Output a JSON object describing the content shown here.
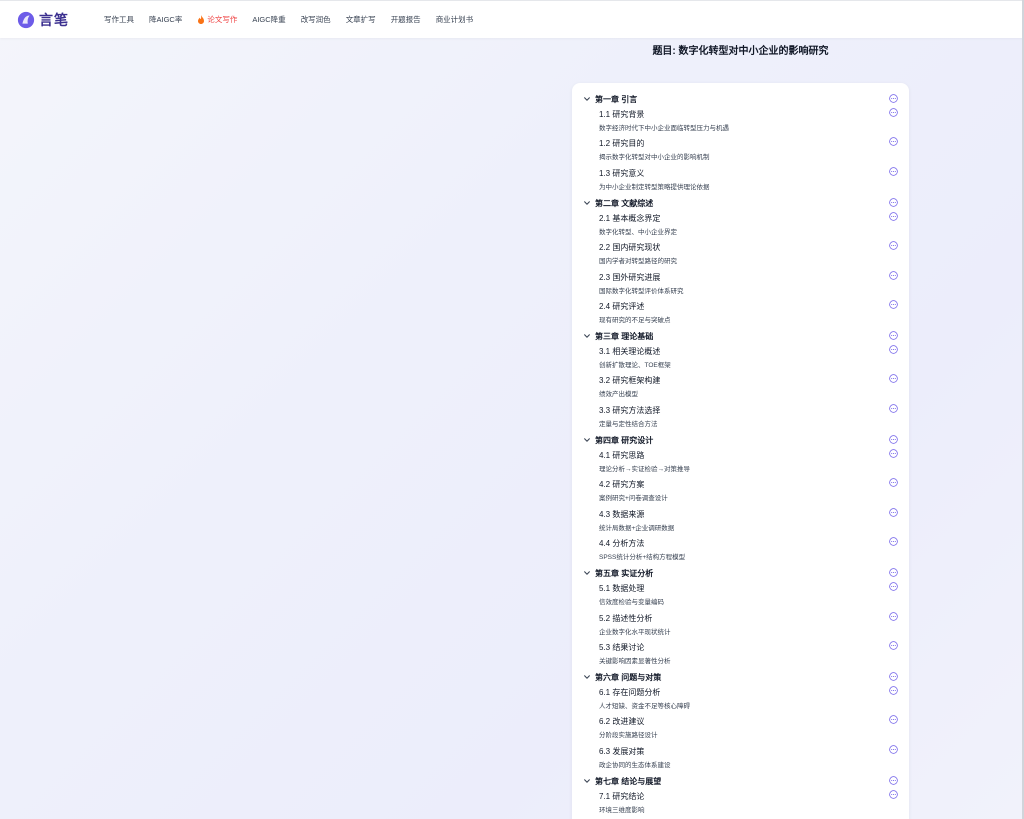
{
  "brand": {
    "name": "言笔"
  },
  "nav": [
    {
      "label": "写作工具",
      "active": false
    },
    {
      "label": "降AIGC率",
      "active": false
    },
    {
      "label": "论文写作",
      "active": true
    },
    {
      "label": "AIGC降重",
      "active": false
    },
    {
      "label": "改写润色",
      "active": false
    },
    {
      "label": "文章扩写",
      "active": false
    },
    {
      "label": "开题报告",
      "active": false
    },
    {
      "label": "商业计划书",
      "active": false
    }
  ],
  "paper": {
    "title": "题目: 数字化转型对中小企业的影响研究"
  },
  "outline": [
    {
      "title": "第一章 引言",
      "sections": [
        {
          "title": "1.1 研究背景",
          "desc": "数字经济时代下中小企业面临转型压力与机遇"
        },
        {
          "title": "1.2 研究目的",
          "desc": "揭示数字化转型对中小企业的影响机制"
        },
        {
          "title": "1.3 研究意义",
          "desc": "为中小企业制定转型策略提供理论依据"
        }
      ]
    },
    {
      "title": "第二章 文献综述",
      "sections": [
        {
          "title": "2.1 基本概念界定",
          "desc": "数字化转型、中小企业界定"
        },
        {
          "title": "2.2 国内研究现状",
          "desc": "国内学者对转型路径的研究"
        },
        {
          "title": "2.3 国外研究进展",
          "desc": "国际数字化转型评价体系研究"
        },
        {
          "title": "2.4 研究评述",
          "desc": "现有研究的不足与突破点"
        }
      ]
    },
    {
      "title": "第三章 理论基础",
      "sections": [
        {
          "title": "3.1 相关理论概述",
          "desc": "创新扩散理论、TOE框架"
        },
        {
          "title": "3.2 研究框架构建",
          "desc": "绩效产出模型"
        },
        {
          "title": "3.3 研究方法选择",
          "desc": "定量与定性结合方法"
        }
      ]
    },
    {
      "title": "第四章 研究设计",
      "sections": [
        {
          "title": "4.1 研究思路",
          "desc": "理论分析→实证检验→对策推导"
        },
        {
          "title": "4.2 研究方案",
          "desc": "案例研究+问卷调查设计"
        },
        {
          "title": "4.3 数据来源",
          "desc": "统计局数据+企业调研数据"
        },
        {
          "title": "4.4 分析方法",
          "desc": "SPSS统计分析+结构方程模型"
        }
      ]
    },
    {
      "title": "第五章 实证分析",
      "sections": [
        {
          "title": "5.1 数据处理",
          "desc": "信效度检验与变量编码"
        },
        {
          "title": "5.2 描述性分析",
          "desc": "企业数字化水平现状统计"
        },
        {
          "title": "5.3 结果讨论",
          "desc": "关键影响因素显著性分析"
        }
      ]
    },
    {
      "title": "第六章 问题与对策",
      "sections": [
        {
          "title": "6.1 存在问题分析",
          "desc": "人才短缺、资金不足等核心障碍"
        },
        {
          "title": "6.2 改进建议",
          "desc": "分阶段实施路径设计"
        },
        {
          "title": "6.3 发展对策",
          "desc": "政企协同的生态体系建设"
        }
      ]
    },
    {
      "title": "第七章 结论与展望",
      "sections": [
        {
          "title": "7.1 研究结论",
          "desc": "环境三维度影响"
        }
      ]
    }
  ],
  "icons": {
    "chapter_toggle": "chevron-down-icon",
    "item_menu": "more-options-icon",
    "active_nav": "fire-icon",
    "logo": "brand-logo-icon"
  },
  "colors": {
    "accent": "#6d5ce8",
    "brand": "#3b2f8f",
    "active_nav": "#ef4444"
  }
}
